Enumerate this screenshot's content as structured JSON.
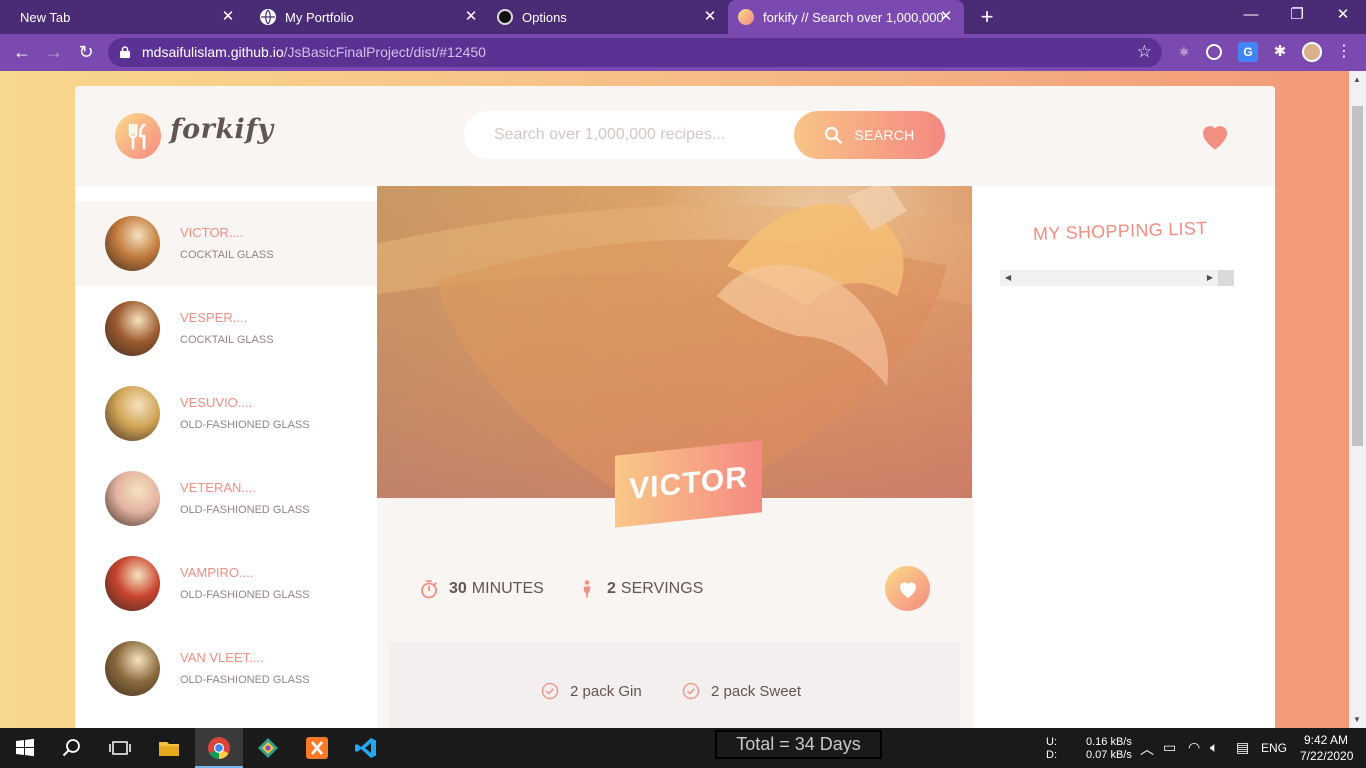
{
  "browser": {
    "tabs": [
      {
        "title": "New Tab",
        "active": false
      },
      {
        "title": "My Portfolio",
        "active": false
      },
      {
        "title": "Options",
        "active": false
      },
      {
        "title": "forkify // Search over 1,000,000 r",
        "active": true
      }
    ],
    "url_host": "mdsaifulislam.github.io",
    "url_path": "/JsBasicFinalProject/dist/#12450"
  },
  "app": {
    "logo_text": "forkify",
    "search": {
      "placeholder": "Search over 1,000,000 recipes...",
      "button_label": "SEARCH"
    },
    "results": [
      {
        "name": "VICTOR....",
        "glass": "COCKTAIL GLASS",
        "active": true,
        "color": "#c27a3c"
      },
      {
        "name": "VESPER....",
        "glass": "COCKTAIL GLASS",
        "active": false,
        "color": "#9c5a2e"
      },
      {
        "name": "VESUVIO....",
        "glass": "OLD-FASHIONED GLASS",
        "active": false,
        "color": "#d0a455"
      },
      {
        "name": "VETERAN....",
        "glass": "OLD-FASHIONED GLASS",
        "active": false,
        "color": "#e4b3a0"
      },
      {
        "name": "VAMPIRO....",
        "glass": "OLD-FASHIONED GLASS",
        "active": false,
        "color": "#c8432d"
      },
      {
        "name": "VAN VLEET....",
        "glass": "OLD-FASHIONED GLASS",
        "active": false,
        "color": "#8a6a3c"
      }
    ],
    "recipe": {
      "title": "VICTOR",
      "minutes": "30",
      "minutes_label": "MINUTES",
      "servings": "2",
      "servings_label": "SERVINGS",
      "ingredients": [
        {
          "count": "2 pack",
          "name": "Gin"
        },
        {
          "count": "2 pack",
          "name": "Sweet"
        }
      ]
    },
    "shopping": {
      "title": "MY SHOPPING LIST"
    }
  },
  "taskbar": {
    "days_label": "Total = 34 Days",
    "net_up_label": "U:",
    "net_down_label": "D:",
    "net_up": "0.16 kB/s",
    "net_down": "0.07 kB/s",
    "lang": "ENG",
    "time": "9:42 AM",
    "date": "7/22/2020"
  },
  "colors": {
    "accent": "#f38e82",
    "gradient_start": "#fbdb89",
    "gradient_end": "#f48982",
    "text": "#615551"
  }
}
